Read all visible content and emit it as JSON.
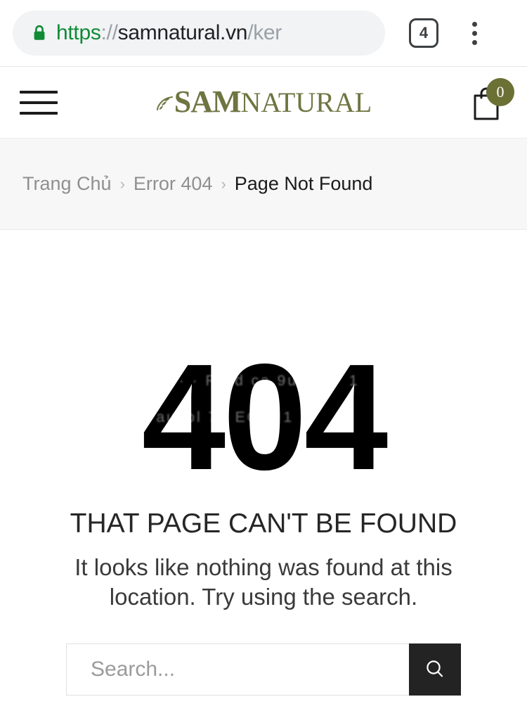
{
  "browser": {
    "security_icon": "lock-icon",
    "url": {
      "scheme": "https",
      "separator": "://",
      "host": "samnatural.vn",
      "path": "/ker"
    },
    "tab_count": "4",
    "menu_icon": "three-dots-vertical-icon",
    "colors": {
      "secure_green": "#0f8b36",
      "omnibox_bg": "#f1f3f4",
      "muted": "#9aa0a6"
    }
  },
  "header": {
    "menu_icon": "hamburger-icon",
    "brand": {
      "leaf_icon": "leaf-icon",
      "first": "SAM",
      "second": "NATURAL",
      "color": "#6f7541"
    },
    "cart": {
      "icon": "shopping-bag-icon",
      "count": "0",
      "badge_color": "#6b7035"
    }
  },
  "breadcrumb": {
    "separator": "›",
    "items": [
      {
        "label": "Trang Chủ",
        "current": false
      },
      {
        "label": "Error 404",
        "current": false
      },
      {
        "label": "Page Not Found",
        "current": true
      }
    ]
  },
  "main": {
    "error_code": "404",
    "watermark_text": "ta · · Re d ca 9u EG · 1 aucol 7u EG 8 1",
    "headline": "THAT PAGE CAN'T BE FOUND",
    "subtext": "It looks like nothing was found at this location. Try using the search.",
    "search": {
      "value": "",
      "placeholder": "Search...",
      "button_icon": "search-icon",
      "button_color": "#232323"
    }
  }
}
